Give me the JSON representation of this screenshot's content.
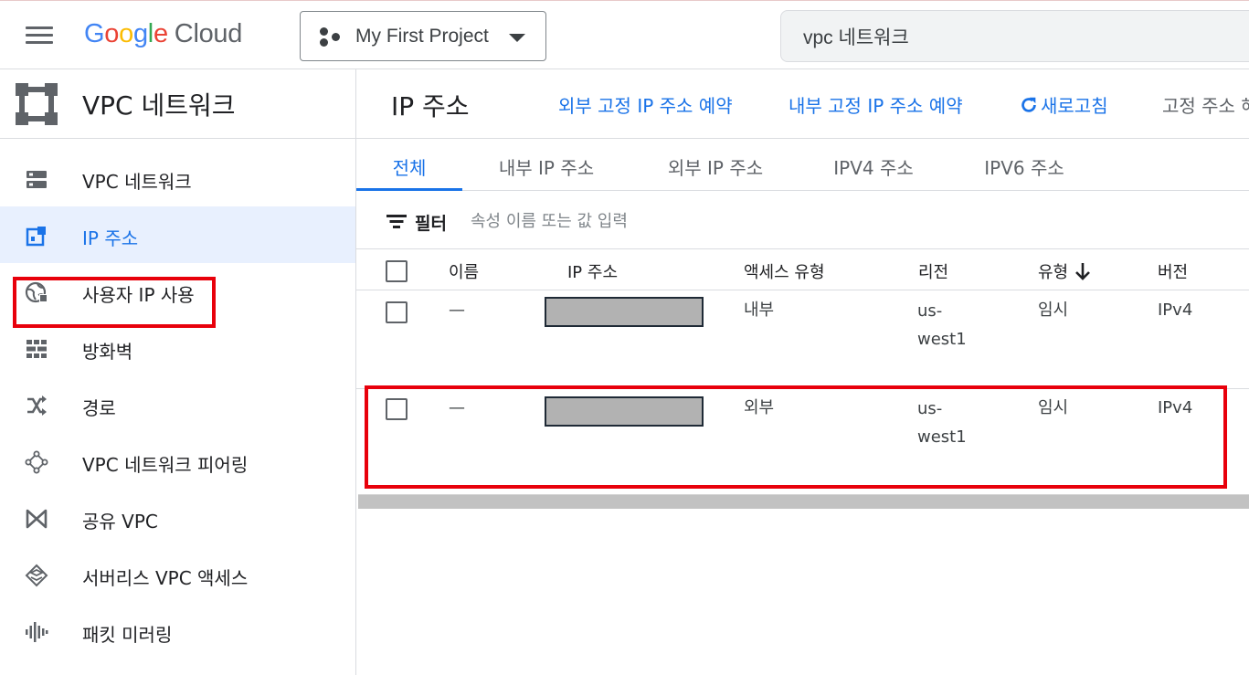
{
  "topbar": {
    "logo_google": [
      "G",
      "o",
      "o",
      "g",
      "l",
      "e"
    ],
    "logo_cloud": "Cloud",
    "project": "My First Project",
    "search_value": "vpc 네트워크"
  },
  "sidebar": {
    "title": "VPC 네트워크",
    "items": [
      {
        "label": "VPC 네트워크",
        "icon": "vpc-network-icon"
      },
      {
        "label": "IP 주소",
        "icon": "ip-address-icon",
        "active": true
      },
      {
        "label": "사용자 IP 사용",
        "icon": "globe-icon"
      },
      {
        "label": "방화벽",
        "icon": "firewall-icon"
      },
      {
        "label": "경로",
        "icon": "routes-icon"
      },
      {
        "label": "VPC 네트워크 피어링",
        "icon": "peering-icon"
      },
      {
        "label": "공유 VPC",
        "icon": "shared-vpc-icon"
      },
      {
        "label": "서버리스 VPC 액세스",
        "icon": "serverless-icon"
      },
      {
        "label": "패킷 미러링",
        "icon": "packet-mirroring-icon"
      }
    ]
  },
  "page": {
    "title": "IP 주소",
    "actions": {
      "reserve_external": "외부 고정 IP 주소 예약",
      "reserve_internal": "내부 고정 IP 주소 예약",
      "refresh": "새로고침",
      "release_static": "고정 주소 해"
    },
    "tabs": [
      "전체",
      "내부 IP 주소",
      "외부 IP 주소",
      "IPV4 주소",
      "IPV6 주소"
    ],
    "active_tab": "전체",
    "filter": {
      "label": "필터",
      "placeholder": "속성 이름 또는 값 입력"
    }
  },
  "table": {
    "columns": [
      "이름",
      "IP 주소",
      "액세스 유형",
      "리전",
      "유형",
      "버전"
    ],
    "sorted_column": "유형",
    "sort_direction": "descending",
    "rows": [
      {
        "name": "—",
        "ip": "",
        "access": "내부",
        "region_line1": "us-",
        "region_line2": "west1",
        "type": "임시",
        "version": "IPv4"
      },
      {
        "name": "—",
        "ip": "",
        "access": "외부",
        "region_line1": "us-",
        "region_line2": "west1",
        "type": "임시",
        "version": "IPv4"
      }
    ]
  },
  "colors": {
    "accent": "#1a73e8",
    "highlight_box": "#e8000b",
    "redaction": "#b2b2b2"
  }
}
